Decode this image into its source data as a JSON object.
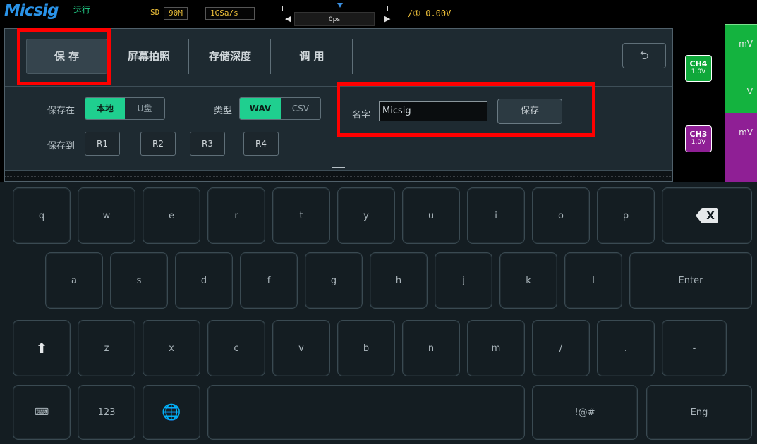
{
  "topbar": {
    "logo": "Micsig",
    "run_status": "运行",
    "sd": "SD",
    "memory": "90M",
    "sample_rate": "1GSa/s",
    "time_offset": "0ps",
    "trigger_level": "0.00V",
    "trigger_icon": "rising-edge-1-icon"
  },
  "channels": {
    "ch4": {
      "name": "CH4",
      "scale": "1.0V",
      "color": "#0fa83a"
    },
    "ch3": {
      "name": "CH3",
      "scale": "1.0V",
      "color": "#8f1f95"
    },
    "strip_labels": [
      "mV",
      "V",
      "mV"
    ]
  },
  "tabs": [
    {
      "label": "保 存",
      "active": true
    },
    {
      "label": "屏幕拍照",
      "active": false
    },
    {
      "label": "存储深度",
      "active": false
    },
    {
      "label": "调 用",
      "active": false
    }
  ],
  "save_panel": {
    "save_location_label": "保存在",
    "location_options": [
      "本地",
      "U盘"
    ],
    "selected_location": "本地",
    "type_label": "类型",
    "type_options": [
      "WAV",
      "CSV"
    ],
    "selected_type": "WAV",
    "save_to_label": "保存到",
    "ref_slots": [
      "R1",
      "R2",
      "R3",
      "R4"
    ],
    "name_label": "名字",
    "name_value": "Micsig",
    "save_button": "保存"
  },
  "keyboard": {
    "row1": [
      "q",
      "w",
      "e",
      "r",
      "t",
      "y",
      "u",
      "i",
      "o",
      "p"
    ],
    "row2": [
      "a",
      "s",
      "d",
      "f",
      "g",
      "h",
      "j",
      "k",
      "l"
    ],
    "enter": "Enter",
    "row3": [
      "z",
      "x",
      "c",
      "v",
      "b",
      "n",
      "m",
      "/",
      ".",
      "-"
    ],
    "numbers_key": "123",
    "symbols_key": "!@#",
    "lang_key": "Eng",
    "accent_color": "#1fcf8f"
  }
}
